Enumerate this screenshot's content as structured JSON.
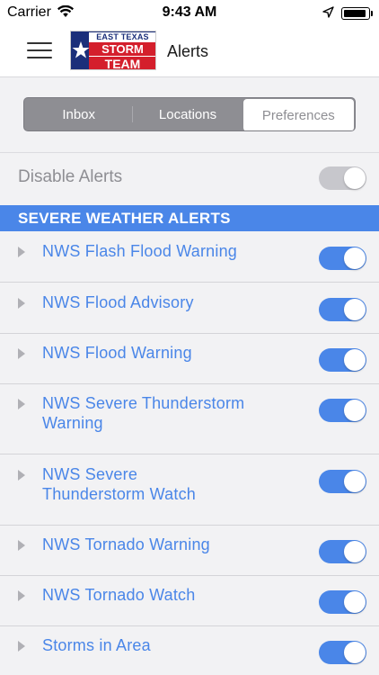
{
  "status_bar": {
    "carrier": "Carrier",
    "time": "9:43 AM",
    "battery_level": 0.92
  },
  "nav": {
    "title": "Alerts",
    "logo": {
      "line1": "EAST TEXAS",
      "line2": "STORM",
      "line3": "TEAM"
    }
  },
  "tabs": [
    {
      "label": "Inbox",
      "selected": false
    },
    {
      "label": "Locations",
      "selected": false
    },
    {
      "label": "Preferences",
      "selected": true
    }
  ],
  "disable_alerts": {
    "label": "Disable Alerts",
    "enabled": false
  },
  "section": {
    "title": "SEVERE WEATHER ALERTS"
  },
  "alerts": [
    {
      "label": "NWS Flash Flood Warning",
      "enabled": true
    },
    {
      "label": "NWS Flood Advisory",
      "enabled": true
    },
    {
      "label": "NWS Flood Warning",
      "enabled": true
    },
    {
      "label": "NWS Severe Thunderstorm Warning",
      "enabled": true
    },
    {
      "label": "NWS Severe Thunderstorm Watch",
      "enabled": true
    },
    {
      "label": "NWS Tornado Warning",
      "enabled": true
    },
    {
      "label": "NWS Tornado Watch",
      "enabled": true
    },
    {
      "label": "Storms in Area",
      "enabled": true
    }
  ],
  "colors": {
    "accent": "#4a86e8",
    "background": "#f2f2f4",
    "toggle_off": "#c7c7cc",
    "logo_red": "#d41f2c",
    "logo_blue": "#1b2f7a"
  }
}
